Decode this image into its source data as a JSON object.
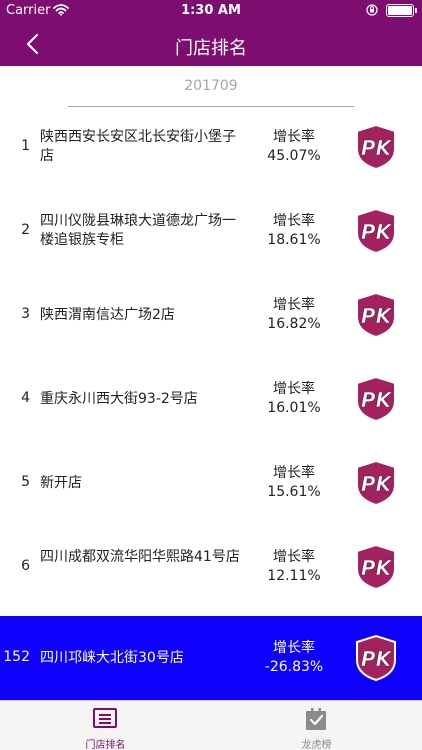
{
  "status_bar": {
    "carrier": "Carrier",
    "time": "1:30 AM"
  },
  "nav": {
    "title": "门店排名"
  },
  "period": "201709",
  "rows": [
    {
      "rank": "1",
      "name": "陕西西安长安区北长安街小堡子店",
      "metric_label": "增长率",
      "metric_value": "45.07%",
      "highlight": false
    },
    {
      "rank": "2",
      "name": "四川仪陇县琳琅大道德龙广场一楼追银族专柜",
      "metric_label": "增长率",
      "metric_value": "18.61%",
      "highlight": false
    },
    {
      "rank": "3",
      "name": "陕西渭南信达广场2店",
      "metric_label": "增长率",
      "metric_value": "16.82%",
      "highlight": false
    },
    {
      "rank": "4",
      "name": "重庆永川西大街93-2号店",
      "metric_label": "增长率",
      "metric_value": "16.01%",
      "highlight": false
    },
    {
      "rank": "5",
      "name": "新开店",
      "metric_label": "增长率",
      "metric_value": "15.61%",
      "highlight": false
    },
    {
      "rank": "6",
      "name": "四川成都双流华阳华熙路41号店",
      "metric_label": "增长率",
      "metric_value": "12.11%",
      "highlight": false
    },
    {
      "rank": "152",
      "name": "四川邛崃大北街30号店",
      "metric_label": "增长率",
      "metric_value": "-26.83%",
      "highlight": true
    }
  ],
  "pk_badge": {
    "text": "PK"
  },
  "tabs": [
    {
      "label": "门店排名",
      "icon": "list-icon",
      "active": true
    },
    {
      "label": "龙虎榜",
      "icon": "clipboard-check-icon",
      "active": false
    }
  ],
  "colors": {
    "brand": "#7d0d6f",
    "highlight": "#0d00fb",
    "badge": "#a3215f"
  }
}
